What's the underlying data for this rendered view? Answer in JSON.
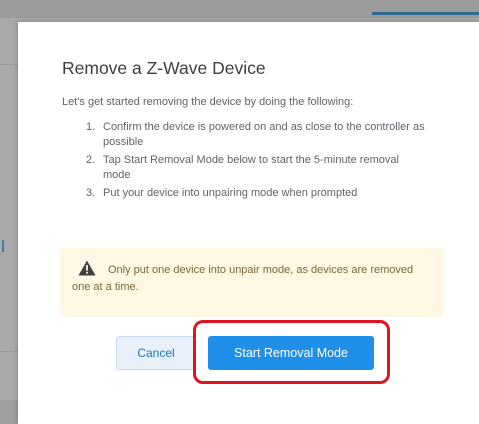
{
  "modal": {
    "title": "Remove a Z-Wave Device",
    "intro": "Let's get started removing the device by doing the following:",
    "steps": [
      {
        "num": "1.",
        "text": "Confirm the device is powered on and as close to the controller as possible"
      },
      {
        "num": "2.",
        "text": "Tap Start Removal Mode below to start the 5-minute removal mode"
      },
      {
        "num": "3.",
        "text": "Put your device into unpairing mode when prompted"
      }
    ],
    "warning": {
      "icon": "warning-triangle-icon",
      "text": "Only put one device into unpair mode, as devices are removed one at a time."
    },
    "buttons": {
      "cancel_label": "Cancel",
      "start_label": "Start Removal Mode"
    }
  },
  "colors": {
    "overlay": "#a9a9a9",
    "primary": "#1f8fea",
    "highlight": "#e0141e",
    "warning_bg": "#fdf7e4"
  }
}
